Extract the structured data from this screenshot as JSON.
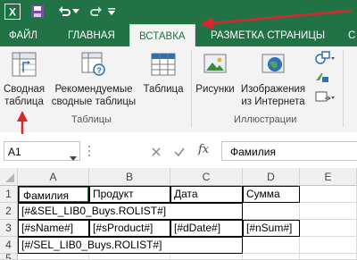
{
  "ribbon_tabs": {
    "file": "ФАЙЛ",
    "home": "ГЛАВНАЯ",
    "insert": "ВСТАВКА",
    "page_layout": "РАЗМЕТКА СТРАНИЦЫ",
    "partial": "С"
  },
  "ribbon": {
    "pivot_table": {
      "line1": "Сводная",
      "line2": "таблица"
    },
    "recommended_pivot": {
      "line1": "Рекомендуемые",
      "line2": "сводные таблицы"
    },
    "table": {
      "line1": "Таблица"
    },
    "tables_group": "Таблицы",
    "pictures": {
      "line1": "Рисунки"
    },
    "online_pictures": {
      "line1": "Изображения",
      "line2": "из Интернета"
    },
    "illustrations_group": "Иллюстрации"
  },
  "formula_bar": {
    "name_box": "A1",
    "fx_label": "fx",
    "value": "Фамилия"
  },
  "grid": {
    "columns": [
      "A",
      "B",
      "C",
      "D",
      "E"
    ],
    "rows": [
      "1",
      "2",
      "3",
      "4",
      "5"
    ],
    "r1": {
      "a": "Фамилия",
      "b": "Продукт",
      "c": "Дата",
      "d": "Сумма"
    },
    "r2": {
      "a": "[#&SEL_LIB0_Buys.ROLIST#]"
    },
    "r3": {
      "a": "[#sName#]",
      "b": "[#sProduct#]",
      "c": "[#dDate#]",
      "d": "[#nSum#]"
    },
    "r4": {
      "a": "[#/SEL_LIB0_Buys.ROLIST#]"
    }
  },
  "colors": {
    "excel_green": "#217346",
    "annotation_red": "#d9262c"
  },
  "icons": [
    "excel-logo-icon",
    "save-icon",
    "undo-icon",
    "redo-icon",
    "pivot-table-icon",
    "recommended-pivot-icon",
    "table-icon",
    "pictures-icon",
    "online-pictures-icon",
    "shapes-icon",
    "smartart-icon",
    "screenshot-icon",
    "cancel-icon",
    "enter-icon",
    "function-icon"
  ]
}
